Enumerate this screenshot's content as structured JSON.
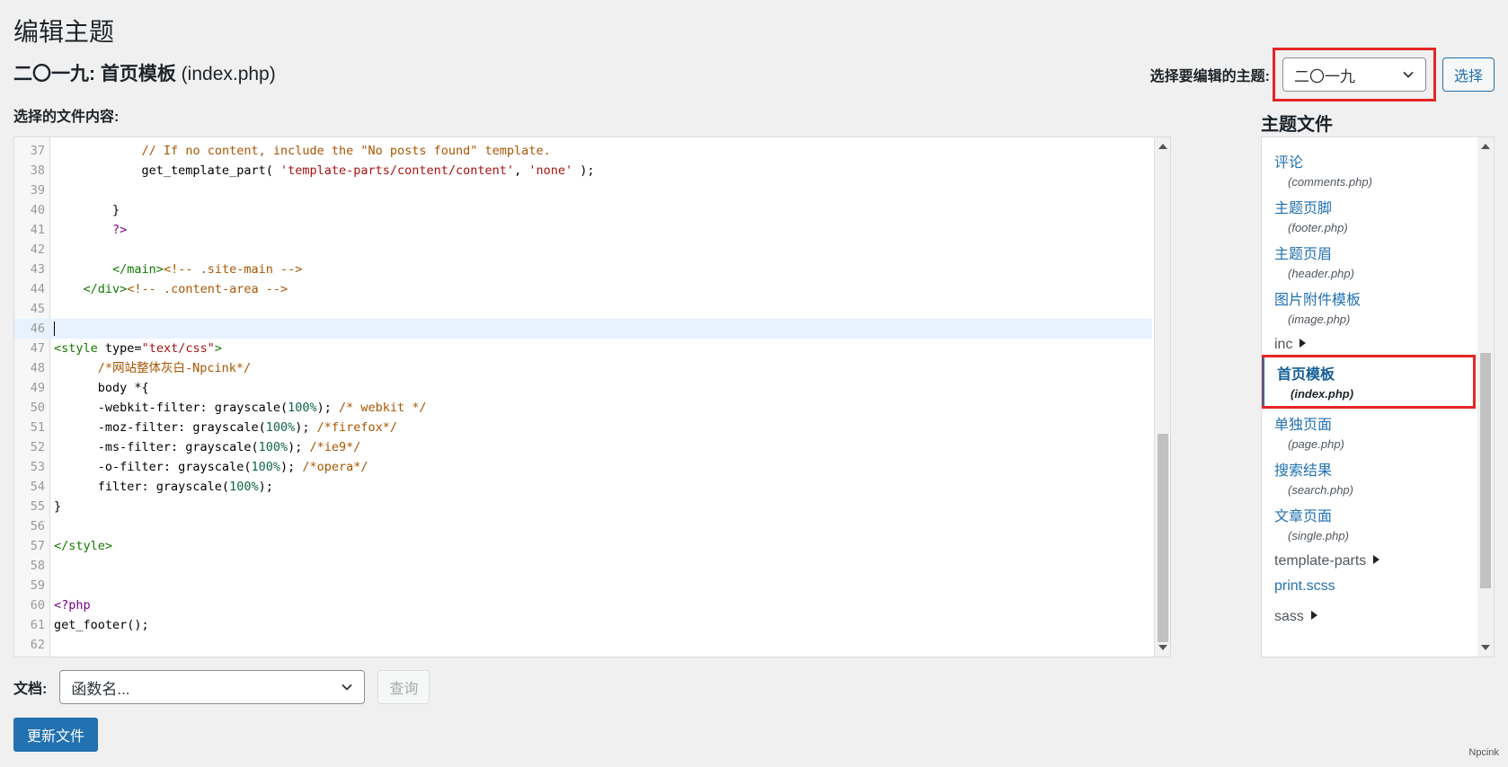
{
  "page_title": "编辑主题",
  "file_title": {
    "theme": "二〇一九: 首页模板",
    "file": "(index.php)"
  },
  "theme_select": {
    "label": "选择要编辑的主题:",
    "value": "二〇一九",
    "button": "选择"
  },
  "file_content_label": "选择的文件内容:",
  "editor": {
    "active_line": 46,
    "lines": [
      {
        "n": "37",
        "html": "            <span class=\"c-comment\">// If no content, include the \"No posts found\" template.</span>"
      },
      {
        "n": "38",
        "html": "            get_template_part( <span class=\"c-string\">'template-parts/content/content'</span>, <span class=\"c-string\">'none'</span> );"
      },
      {
        "n": "39",
        "html": ""
      },
      {
        "n": "40",
        "html": "        }"
      },
      {
        "n": "41",
        "html": "        <span class=\"c-keyword\">?&gt;</span>"
      },
      {
        "n": "42",
        "html": ""
      },
      {
        "n": "43",
        "html": "        <span class=\"c-tag\">&lt;/main&gt;</span><span class=\"c-comment\">&lt;!-- .site-main --&gt;</span>"
      },
      {
        "n": "44",
        "html": "    <span class=\"c-tag\">&lt;/div&gt;</span><span class=\"c-comment\">&lt;!-- .content-area --&gt;</span>"
      },
      {
        "n": "45",
        "html": ""
      },
      {
        "n": "46",
        "html": "<span class=\"cursor\"></span>"
      },
      {
        "n": "47",
        "html": "<span class=\"c-tag\">&lt;style</span> type=<span class=\"c-string\">\"text/css\"</span><span class=\"c-tag\">&gt;</span>"
      },
      {
        "n": "48",
        "html": "      <span class=\"c-comment\">/*网站整体灰白-Npcink*/</span>"
      },
      {
        "n": "49",
        "html": "      body *{"
      },
      {
        "n": "50",
        "html": "      -webkit-filter: grayscale(<span class=\"c-num\">100%</span>); <span class=\"c-comment\">/* webkit */</span>"
      },
      {
        "n": "51",
        "html": "      -moz-filter: grayscale(<span class=\"c-num\">100%</span>); <span class=\"c-comment\">/*firefox*/</span>"
      },
      {
        "n": "52",
        "html": "      -ms-filter: grayscale(<span class=\"c-num\">100%</span>); <span class=\"c-comment\">/*ie9*/</span>"
      },
      {
        "n": "53",
        "html": "      -o-filter: grayscale(<span class=\"c-num\">100%</span>); <span class=\"c-comment\">/*opera*/</span>"
      },
      {
        "n": "54",
        "html": "      filter: grayscale(<span class=\"c-num\">100%</span>);"
      },
      {
        "n": "55",
        "html": "}"
      },
      {
        "n": "56",
        "html": ""
      },
      {
        "n": "57",
        "html": "<span class=\"c-tag\">&lt;/style&gt;</span>"
      },
      {
        "n": "58",
        "html": ""
      },
      {
        "n": "59",
        "html": ""
      },
      {
        "n": "60",
        "html": "<span class=\"c-keyword\">&lt;?php</span>"
      },
      {
        "n": "61",
        "html": "get_footer();"
      },
      {
        "n": "62",
        "html": ""
      }
    ]
  },
  "sidebar": {
    "title": "主题文件",
    "items": [
      {
        "type": "file",
        "label": "评论",
        "sub": "(comments.php)"
      },
      {
        "type": "file",
        "label": "主题页脚",
        "sub": "(footer.php)"
      },
      {
        "type": "file",
        "label": "主题页眉",
        "sub": "(header.php)"
      },
      {
        "type": "file",
        "label": "图片附件模板",
        "sub": "(image.php)"
      },
      {
        "type": "folder",
        "label": "inc"
      },
      {
        "type": "file",
        "label": "首页模板",
        "sub": "(index.php)",
        "current": true
      },
      {
        "type": "file",
        "label": "单独页面",
        "sub": "(page.php)"
      },
      {
        "type": "file",
        "label": "搜索结果",
        "sub": "(search.php)"
      },
      {
        "type": "file",
        "label": "文章页面",
        "sub": "(single.php)"
      },
      {
        "type": "folder",
        "label": "template-parts"
      },
      {
        "type": "plain",
        "label": "print.scss"
      },
      {
        "type": "folder",
        "label": "sass"
      }
    ]
  },
  "doc": {
    "label": "文档:",
    "placeholder": "函数名...",
    "button": "查询"
  },
  "update_button": "更新文件",
  "watermark": "Npcink"
}
